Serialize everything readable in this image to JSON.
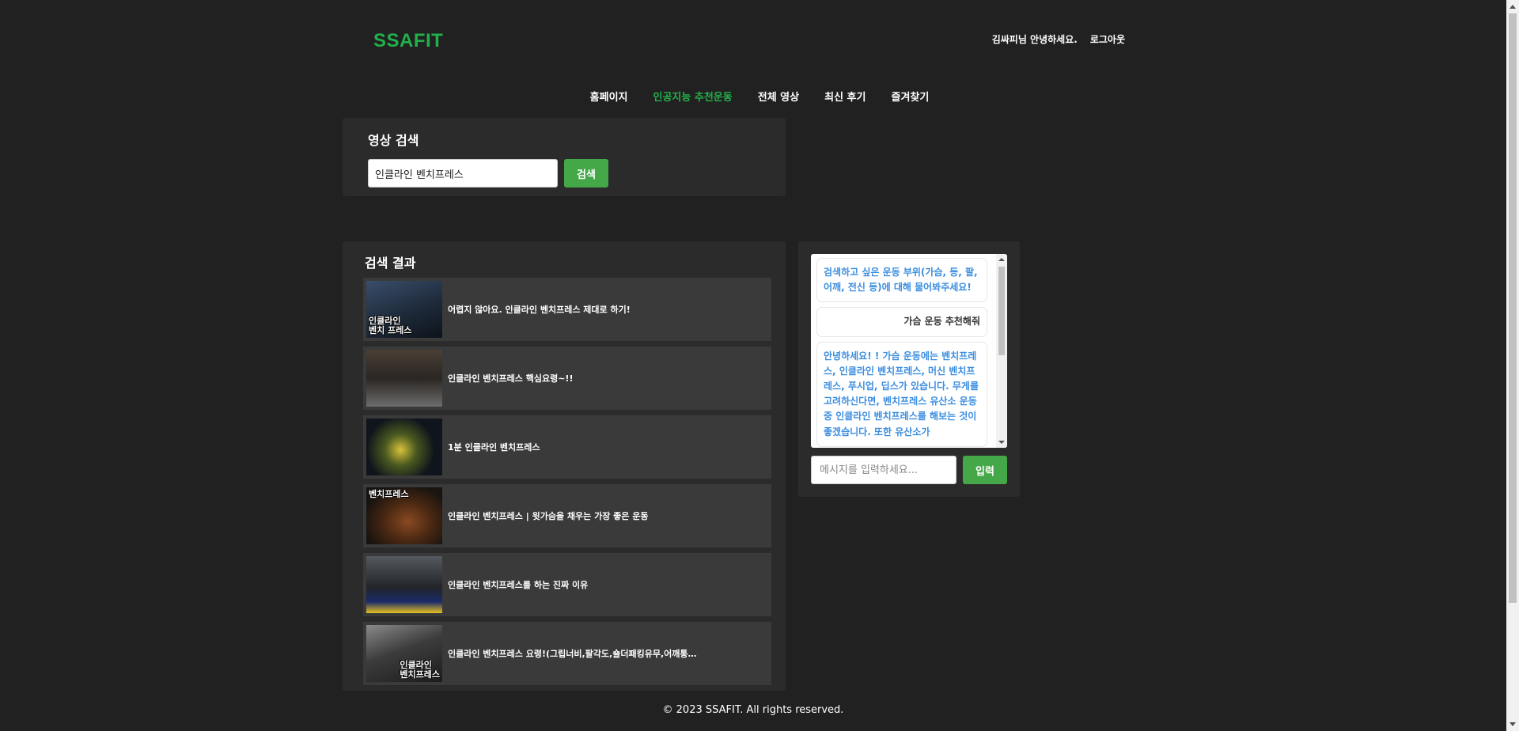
{
  "header": {
    "logo": "SSAFIT",
    "greeting": "김싸피님 안녕하세요.",
    "logout": "로그아웃"
  },
  "nav": {
    "items": [
      {
        "label": "홈페이지",
        "active": false
      },
      {
        "label": "인공지능 추천운동",
        "active": true
      },
      {
        "label": "전체 영상",
        "active": false
      },
      {
        "label": "최신 후기",
        "active": false
      },
      {
        "label": "즐겨찾기",
        "active": false
      }
    ]
  },
  "search": {
    "title": "영상 검색",
    "value": "인클라인 벤치프레스",
    "button": "검색"
  },
  "results": {
    "title": "검색 결과",
    "items": [
      {
        "title": "어렵지 않아요. 인클라인 벤치프레스 제대로 하기!",
        "thumb_text": "인클라인\n벤치 프레스",
        "thumb_color": "#1e2a3a"
      },
      {
        "title": "인클라인 벤치프레스 핵심요령~!!",
        "thumb_text": "",
        "thumb_color": "#2a2622"
      },
      {
        "title": "1분 인클라인 벤치프레스",
        "thumb_text": "",
        "thumb_color": "#10141c"
      },
      {
        "title": "인클라인 벤치프레스 | 윗가슴을 채우는 가장 좋은 운동",
        "thumb_text": "벤치프레스",
        "thumb_color": "#1a1410"
      },
      {
        "title": "인클라인 벤치프레스를 하는 진짜 이유",
        "thumb_text": "",
        "thumb_color": "#222428"
      },
      {
        "title": "인클라인 벤치프레스 요령!(그립너비,팔각도,숄더패킹유무,어깨통…",
        "thumb_text": "인클라인\n벤치프레스",
        "thumb_color": "#1c1c1c"
      }
    ]
  },
  "chat": {
    "messages": [
      {
        "role": "bot",
        "text": "검색하고 싶은 운동 부위(가슴, 등, 팔, 어깨, 전신 등)에 대해 물어봐주세요!"
      },
      {
        "role": "user",
        "text": "가슴 운동 추천해줘"
      },
      {
        "role": "bot",
        "text": "안녕하세요! ! 가슴 운동에는 벤치프레스, 인클라인 벤치프레스, 머신 벤치프레스, 푸시업, 딥스가 있습니다. 무게를 고려하신다면, 벤치프레스 유산소 운동 중 인클라인 벤치프레스를 해보는 것이 좋겠습니다. 또한 유산소가"
      }
    ],
    "placeholder": "메시지를 입력하세요...",
    "send": "입력"
  },
  "footer": {
    "text": "© 2023 SSAFIT. All rights reserved."
  },
  "colors": {
    "background": "#212121",
    "panel": "#2b2b2b",
    "accent_green": "#22b04b",
    "button_green": "#45a848",
    "bot_text": "#3b8ee0"
  }
}
